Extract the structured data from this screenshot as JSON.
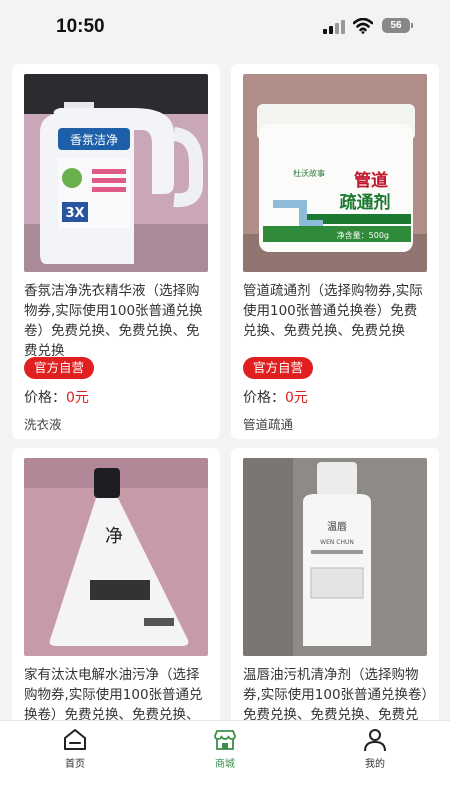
{
  "status_bar": {
    "time": "10:50",
    "battery": "56"
  },
  "products": [
    {
      "title": "香氛洁净洗衣精华液（选择购物券,实际使用100张普通兑换卷）免费兑换、免费兑换、免费兑换",
      "badge": "官方自营",
      "price_label": "价格：",
      "price_value": "0元",
      "category": "洗衣液",
      "image": "laundry-detergent-bottle"
    },
    {
      "title": "管道疏通剂（选择购物券,实际使用100张普通兑换卷）免费兑换、免费兑换、免费兑换",
      "badge": "官方自营",
      "price_label": "价格：",
      "price_value": "0元",
      "category": "管道疏通",
      "image": "pipe-dredge-jar"
    },
    {
      "title": "家有汰汰电解水油污净（选择购物券,实际使用100张普通兑换卷）免费兑换、免费兑换、免费兑换",
      "image": "degreaser-triangle-bottle"
    },
    {
      "title": "温唇油污机清净剂（选择购物券,实际使用100张普通兑换卷）免费兑换、免费兑换、免费兑换",
      "image": "oil-cleaner-bottle"
    }
  ],
  "tabbar": {
    "items": [
      {
        "label": "首页",
        "icon": "home-icon"
      },
      {
        "label": "商城",
        "icon": "store-icon",
        "active": true
      },
      {
        "label": "我的",
        "icon": "person-icon"
      }
    ]
  },
  "colors": {
    "accent_red": "#e02020",
    "active_green": "#3c8f4a"
  }
}
